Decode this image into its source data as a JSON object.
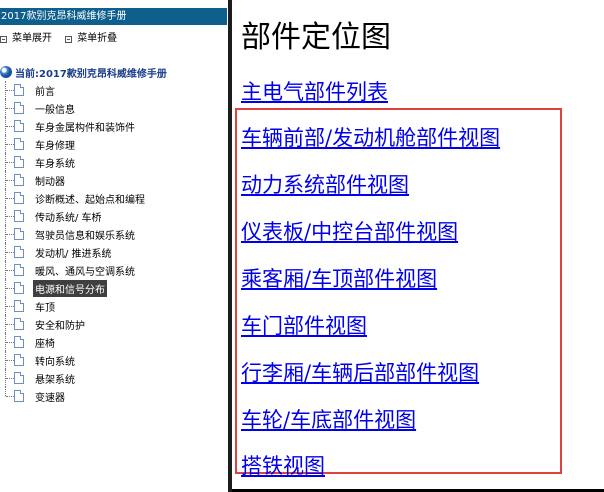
{
  "sidebar": {
    "app_title": "2017款别克昂科威维修手册",
    "toolbar": {
      "expand_label": "菜单展开",
      "collapse_label": "菜单折叠"
    },
    "root_label": "当前:2017款别克昂科威维修手册",
    "items": [
      {
        "label": "前言"
      },
      {
        "label": "一般信息"
      },
      {
        "label": "车身金属构件和装饰件"
      },
      {
        "label": "车身修理"
      },
      {
        "label": "车身系统"
      },
      {
        "label": "制动器"
      },
      {
        "label": "诊断概述、起始点和编程"
      },
      {
        "label": "传动系统/ 车桥"
      },
      {
        "label": "驾驶员信息和娱乐系统"
      },
      {
        "label": "发动机/ 推进系统"
      },
      {
        "label": "暖风、通风与空调系统"
      },
      {
        "label": "电源和信号分布"
      },
      {
        "label": "车顶"
      },
      {
        "label": "安全和防护"
      },
      {
        "label": "座椅"
      },
      {
        "label": "转向系统"
      },
      {
        "label": "悬架系统"
      },
      {
        "label": "变速器"
      }
    ],
    "selected_label": "电源和信号分布"
  },
  "content": {
    "heading": "部件定位图",
    "links": [
      {
        "label": "主电气部件列表"
      },
      {
        "label": "车辆前部/发动机舱部件视图"
      },
      {
        "label": "动力系统部件视图"
      },
      {
        "label": "仪表板/中控台部件视图"
      },
      {
        "label": "乘客厢/车顶部件视图"
      },
      {
        "label": "车门部件视图"
      },
      {
        "label": "行李厢/车辆后部部件视图"
      },
      {
        "label": "车轮/车底部件视图"
      },
      {
        "label": "搭铁视图"
      }
    ]
  },
  "colors": {
    "title_bar": "#0f5f8c",
    "link": "#0000ee",
    "highlight_border": "#e0433f",
    "selected_bg": "#3f3f3f"
  }
}
